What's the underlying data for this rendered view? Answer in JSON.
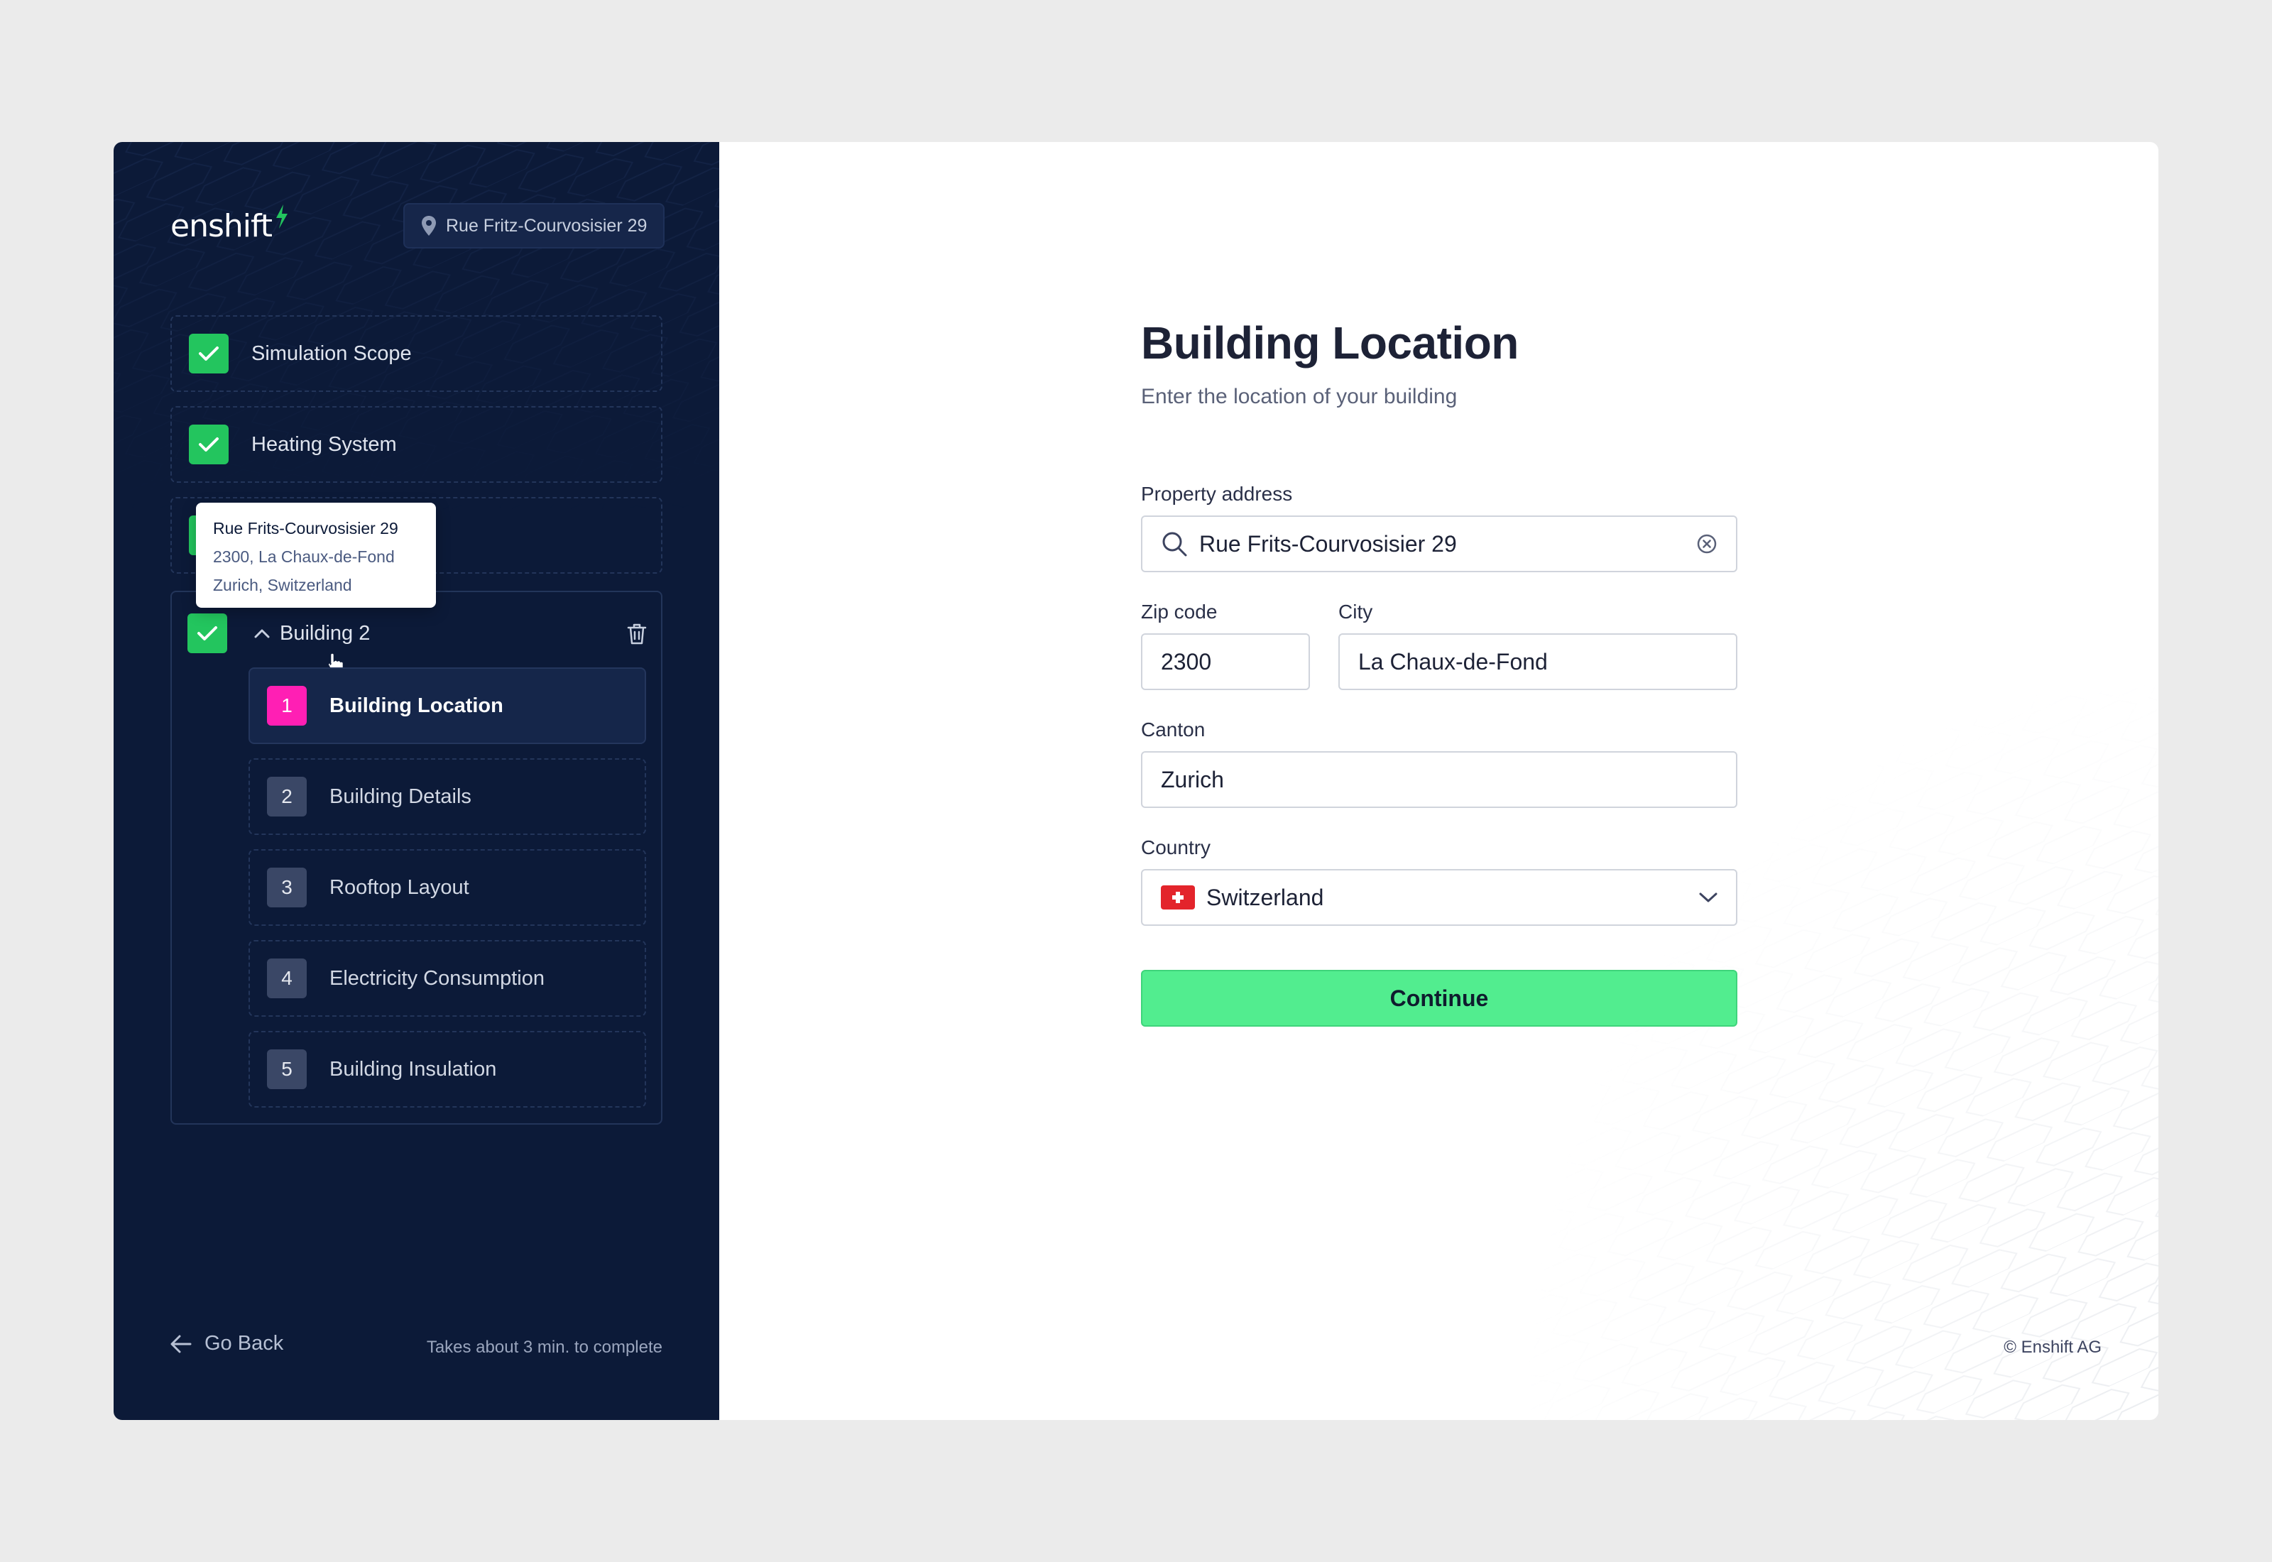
{
  "brand": {
    "name": "enshift",
    "accent": "#23c55e"
  },
  "header": {
    "address_pill": "Rue Fritz-Courvosisier 29",
    "address_icon": "map-pin-icon"
  },
  "steps": [
    {
      "label": "Simulation Scope",
      "status": "completed"
    },
    {
      "label": "Heating System",
      "status": "completed"
    },
    {
      "label": "",
      "status": "completed"
    }
  ],
  "tooltip": {
    "line1": "Rue Frits-Courvosisier 29",
    "line2": "2300, La Chaux-de-Fond",
    "line3": "Zurich, Switzerland"
  },
  "building_group": {
    "title": "Building 2",
    "expanded": true,
    "substeps": [
      {
        "number": "1",
        "label": "Building Location",
        "active": true
      },
      {
        "number": "2",
        "label": "Building Details",
        "active": false
      },
      {
        "number": "3",
        "label": "Rooftop Layout",
        "active": false
      },
      {
        "number": "4",
        "label": "Electricity Consumption",
        "active": false
      },
      {
        "number": "5",
        "label": "Building Insulation",
        "active": false
      }
    ]
  },
  "footer": {
    "go_back": "Go Back",
    "duration": "Takes about 3 min. to complete",
    "copyright": "© Enshift AG"
  },
  "form": {
    "title": "Building Location",
    "subtitle": "Enter the location of your building",
    "property_address": {
      "label": "Property address",
      "value": "Rue Frits-Courvosisier 29"
    },
    "zip": {
      "label": "Zip code",
      "value": "2300"
    },
    "city": {
      "label": "City",
      "value": "La Chaux-de-Fond"
    },
    "canton": {
      "label": "Canton",
      "value": "Zurich"
    },
    "country": {
      "label": "Country",
      "value": "Switzerland"
    },
    "continue_label": "Continue"
  },
  "colors": {
    "sidebar_bg": "#0c1a38",
    "active_step": "#ff1fb4",
    "button": "#52ed8f"
  }
}
